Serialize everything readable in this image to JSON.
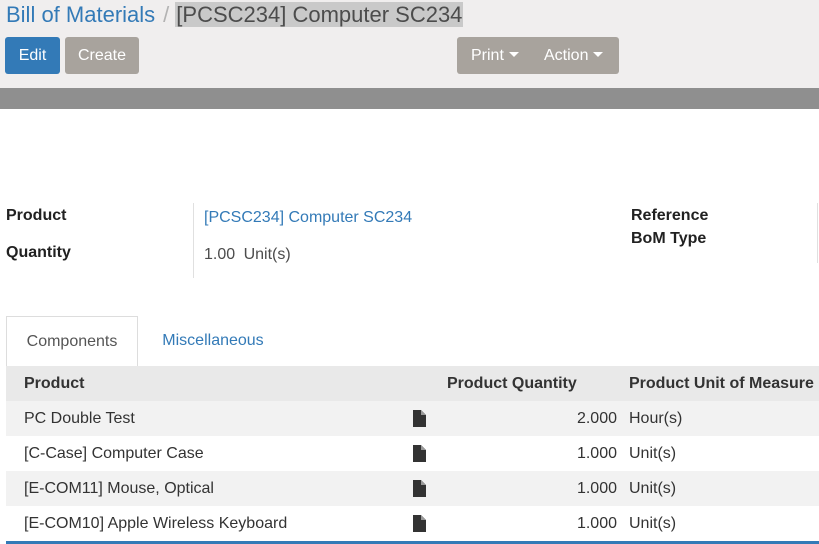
{
  "breadcrumb": {
    "parent": "Bill of Materials",
    "separator": "/",
    "current": "[PCSC234] Computer SC234"
  },
  "toolbar": {
    "edit_label": "Edit",
    "create_label": "Create",
    "print_label": "Print",
    "action_label": "Action"
  },
  "form": {
    "product_label": "Product",
    "product_value": "[PCSC234] Computer SC234",
    "quantity_label": "Quantity",
    "quantity_value": "1.00",
    "quantity_uom": "Unit(s)",
    "reference_label": "Reference",
    "bom_type_label": "BoM Type"
  },
  "tabs": [
    {
      "label": "Components",
      "active": true
    },
    {
      "label": "Miscellaneous",
      "active": false
    }
  ],
  "table": {
    "columns": [
      "Product",
      "Product Quantity",
      "Product Unit of Measure"
    ],
    "rows": [
      {
        "product": "PC Double Test",
        "quantity": "2.000",
        "uom": "Hour(s)"
      },
      {
        "product": "[C-Case] Computer Case",
        "quantity": "1.000",
        "uom": "Unit(s)"
      },
      {
        "product": "[E-COM11] Mouse, Optical",
        "quantity": "1.000",
        "uom": "Unit(s)"
      },
      {
        "product": "[E-COM10] Apple Wireless Keyboard",
        "quantity": "1.000",
        "uom": "Unit(s)"
      }
    ]
  },
  "icons": {
    "row_document": "file-document-icon",
    "dropdown": "caret-down-icon"
  },
  "colors": {
    "primary": "#337ab7",
    "secondary_button": "#a8a39d",
    "control_panel_bg": "#f0eeee",
    "status_bar": "#8f8f8f"
  }
}
